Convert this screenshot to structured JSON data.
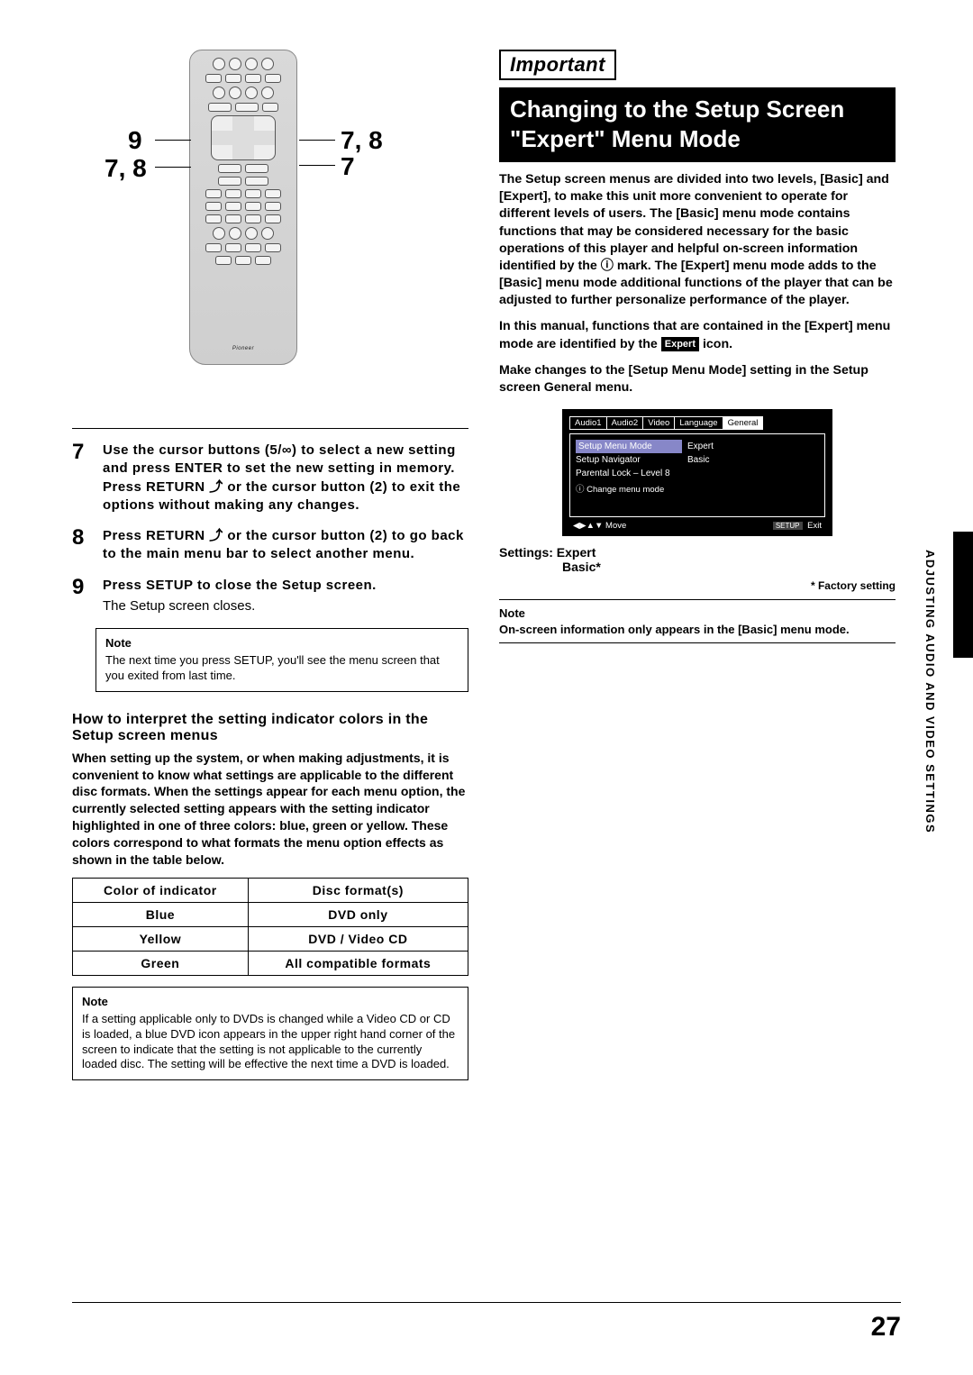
{
  "left": {
    "callouts": {
      "top_left": "9",
      "mid_left": "7, 8",
      "top_right": "7, 8",
      "mid_right": "7"
    },
    "remote_brand": "Pioneer",
    "steps": {
      "s7": {
        "num": "7",
        "text": "Use the cursor buttons (5/∞) to select a new setting and press ENTER to set the new setting in memory. Press RETURN ⤴ or the cursor button (2) to exit the options without making any changes."
      },
      "s8": {
        "num": "8",
        "text": "Press RETURN ⤴ or the cursor button (2) to go back to the main menu bar to select another menu."
      },
      "s9": {
        "num": "9",
        "text": "Press SETUP to close the Setup screen.",
        "sub": "The Setup screen closes."
      }
    },
    "note1_label": "Note",
    "note1": "The next time you press SETUP, you'll see the menu screen that you exited from last time.",
    "interpret_head": "How to interpret the setting indicator colors in the Setup screen menus",
    "interpret_para": "When setting up the system, or when making adjustments, it is convenient to know what settings are applicable to the different disc formats. When the settings appear for each menu option, the currently selected setting appears with the setting indicator highlighted in one of three colors: blue, green or yellow. These colors correspond to what formats the menu option effects as shown in the table below.",
    "table": {
      "h1": "Color of indicator",
      "h2": "Disc format(s)",
      "r1c1": "Blue",
      "r1c2": "DVD only",
      "r2c1": "Yellow",
      "r2c2": "DVD / Video CD",
      "r3c1": "Green",
      "r3c2": "All compatible formats"
    },
    "note2_label": "Note",
    "note2": "If a setting applicable only to DVDs is changed while a Video CD or CD is loaded, a blue DVD icon appears in the upper right hand corner of the screen to indicate that the setting is not applicable to the currently loaded disc. The setting will be effective the next time a DVD is loaded."
  },
  "right": {
    "important": "Important",
    "title": "Changing to the Setup Screen \"Expert\" Menu Mode",
    "p1": "The Setup screen menus are divided into two levels, [Basic] and [Expert], to make this unit more convenient to operate for different levels of users. The [Basic] menu mode contains functions that may be considered necessary for the basic operations of this player and helpful on-screen information identified by the ⓘ mark. The [Expert] menu mode adds to the [Basic] menu mode additional functions of the player that can be adjusted to further personalize performance of the player.",
    "p2a": "In this manual, functions that are contained in the [Expert] menu mode are identified by the ",
    "expert_badge": "Expert",
    "p2b": " icon.",
    "p3": "Make changes to the [Setup Menu Mode] setting in the Setup screen General menu.",
    "osd": {
      "tabs": [
        "Audio1",
        "Audio2",
        "Video",
        "Language",
        "General"
      ],
      "row1k": "Setup Menu Mode",
      "row1v": "Expert",
      "row2k": "Setup Navigator",
      "row2v": "Basic",
      "row3": "Parental Lock – Level 8",
      "info": "ⓘ Change menu mode",
      "foot_left": "◀▶▲▼ Move",
      "foot_chip": "SETUP",
      "foot_right": "Exit"
    },
    "settings_label": "Settings:",
    "settings_v1": "Expert",
    "settings_v2": "Basic*",
    "factory": "* Factory setting",
    "note_label": "Note",
    "note": "On-screen information only appears in the [Basic] menu mode."
  },
  "side_label": "ADJUSTING AUDIO AND VIDEO SETTINGS",
  "page_num": "27"
}
